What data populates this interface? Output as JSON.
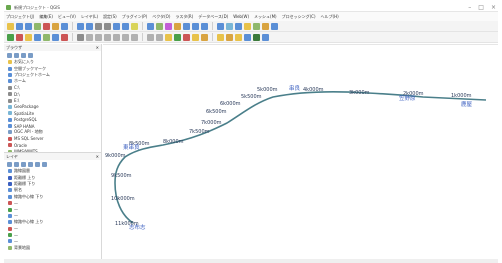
{
  "window": {
    "title": "新規プロジェクト - QGIS",
    "buttons": [
      "–",
      "□",
      "×"
    ]
  },
  "menu": [
    "プロジェクト(J)",
    "編集(E)",
    "ビュー(V)",
    "レイヤ(L)",
    "設定(S)",
    "プラグイン(P)",
    "ベクタ(O)",
    "ラスタ(R)",
    "データベース(D)",
    "Web(W)",
    "メッシュ(M)",
    "プロセッシング(C)",
    "ヘルプ(H)"
  ],
  "toolbar1_colors": [
    "#e8c24a",
    "#5b8fd6",
    "#5b8fd6",
    "#8fb86b",
    "#cc5555",
    "#d9a441",
    "#5b8fd6",
    "#5b8fd6",
    "#5b8fd6",
    "#8c8c8c",
    "#8c8c8c",
    "#5b8fd6",
    "#5b8fd6",
    "#d9d45a",
    "#5b8fd6",
    "#8fb86b",
    "#c35fd6",
    "#d9a441",
    "#5b8fd6",
    "#5b8fd6",
    "#5b8fd6",
    "#5b8fd6",
    "#7ab6d6",
    "#5b8fd6",
    "#e8c24a",
    "#8fb86b",
    "#d9a441",
    "#5b8fd6"
  ],
  "toolbar2_colors": [
    "#4aa04a",
    "#cc5555",
    "#e8c24a",
    "#5b8fd6",
    "#8fb86b",
    "#5b8fd6",
    "#cc5555",
    "#8c8c8c",
    "#b0b0b0",
    "#b0b0b0",
    "#b0b0b0",
    "#b0b0b0",
    "#b0b0b0",
    "#b0b0b0",
    "#b0b0b0",
    "#b0b0b0",
    "#e8c24a",
    "#4aa04a",
    "#cc5555",
    "#e8c24a",
    "#d9a441",
    "#e8c24a",
    "#d9a441",
    "#e8c24a",
    "#5b8fd6",
    "#3b7a3b",
    "#5b8fd6"
  ],
  "browser": {
    "title": "ブラウザ",
    "items": [
      {
        "label": "お気に入り",
        "color": "#e8c24a"
      },
      {
        "label": "空間ブックマーク",
        "color": "#5b8fd6"
      },
      {
        "label": "プロジェクトホーム",
        "color": "#5b8fd6"
      },
      {
        "label": "ホーム",
        "color": "#5b8fd6"
      },
      {
        "label": "C:\\",
        "color": "#8c8c8c"
      },
      {
        "label": "D:\\",
        "color": "#8c8c8c"
      },
      {
        "label": "E:\\",
        "color": "#8c8c8c"
      },
      {
        "label": "GeoPackage",
        "color": "#7ab6d6"
      },
      {
        "label": "SpatiaLite",
        "color": "#7ab6d6"
      },
      {
        "label": "PostgreSQL",
        "color": "#5b8fd6"
      },
      {
        "label": "SAP HANA",
        "color": "#5b8fd6"
      },
      {
        "label": "OGC API - 地物",
        "color": "#7a9cc6"
      },
      {
        "label": "MS SQL Server",
        "color": "#cc5555"
      },
      {
        "label": "Oracle",
        "color": "#cc5555"
      },
      {
        "label": "WMS/WMTS",
        "color": "#8fb86b"
      },
      {
        "label": "Cloud",
        "color": "#7a9cc6"
      }
    ]
  },
  "layers": {
    "title": "レイヤ",
    "items": [
      {
        "label": "路線図層",
        "color": "#5b8fd6"
      },
      {
        "label": "距離標 上り",
        "color": "#3b5fc0"
      },
      {
        "label": "距離標 下り",
        "color": "#3b5fc0"
      },
      {
        "label": "駅名",
        "color": "#5b8fd6"
      },
      {
        "label": "線路中心線 下り",
        "color": "#5b8fd6"
      },
      {
        "label": "—",
        "color": "#cc5555"
      },
      {
        "label": "—",
        "color": "#4aa04a"
      },
      {
        "label": "—",
        "color": "#5b8fd6"
      },
      {
        "label": "線路中心線 上り",
        "color": "#5b8fd6"
      },
      {
        "label": "—",
        "color": "#cc5555"
      },
      {
        "label": "—",
        "color": "#4aa04a"
      },
      {
        "label": "—",
        "color": "#5b8fd6"
      },
      {
        "label": "背景地図",
        "color": "#8fb86b"
      }
    ]
  },
  "map": {
    "line_color": "#4a7f8a",
    "labels": [
      {
        "text": "11k000m",
        "kind": "distance"
      },
      {
        "text": "10k000m",
        "kind": "distance"
      },
      {
        "text": "9k500m",
        "kind": "distance"
      },
      {
        "text": "9k000m",
        "kind": "distance"
      },
      {
        "text": "8k500m",
        "kind": "distance"
      },
      {
        "text": "8k000m",
        "kind": "distance"
      },
      {
        "text": "7k500m",
        "kind": "distance"
      },
      {
        "text": "7k000m",
        "kind": "distance"
      },
      {
        "text": "6k500m",
        "kind": "distance"
      },
      {
        "text": "6k000m",
        "kind": "distance"
      },
      {
        "text": "5k500m",
        "kind": "distance"
      },
      {
        "text": "5k000m",
        "kind": "distance"
      },
      {
        "text": "4k000m",
        "kind": "distance"
      },
      {
        "text": "3k000m",
        "kind": "distance"
      },
      {
        "text": "2k000m",
        "kind": "distance"
      },
      {
        "text": "1k000m",
        "kind": "distance"
      },
      {
        "text": "鹿屋",
        "kind": "station"
      },
      {
        "text": "笠野原",
        "kind": "station"
      },
      {
        "text": "串良",
        "kind": "station"
      },
      {
        "text": "東串良",
        "kind": "station"
      },
      {
        "text": "志布志",
        "kind": "station"
      }
    ]
  }
}
